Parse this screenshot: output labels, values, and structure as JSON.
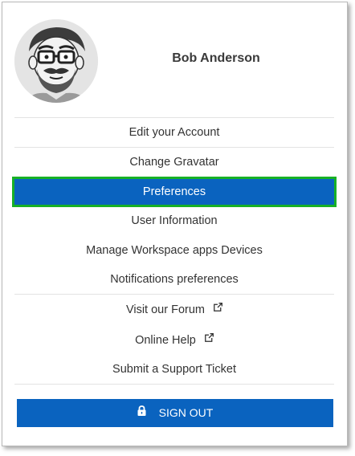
{
  "user": {
    "name": "Bob Anderson"
  },
  "menu": {
    "items": [
      {
        "label": "Edit your Account",
        "external": false
      },
      {
        "label": "Change Gravatar",
        "external": false
      },
      {
        "label": "Preferences",
        "external": false,
        "active": true
      },
      {
        "label": "User Information",
        "external": false
      },
      {
        "label": "Manage Workspace apps Devices",
        "external": false
      },
      {
        "label": "Notifications preferences",
        "external": false
      },
      {
        "label": "Visit our Forum",
        "external": true
      },
      {
        "label": "Online Help",
        "external": true
      },
      {
        "label": "Submit a Support Ticket",
        "external": false
      }
    ]
  },
  "signout": {
    "label": "SIGN OUT",
    "icon": "lock-icon"
  },
  "colors": {
    "primary": "#0a63bf",
    "highlight_outline": "#17b026",
    "text": "#333333",
    "divider": "#e3e3e3"
  }
}
